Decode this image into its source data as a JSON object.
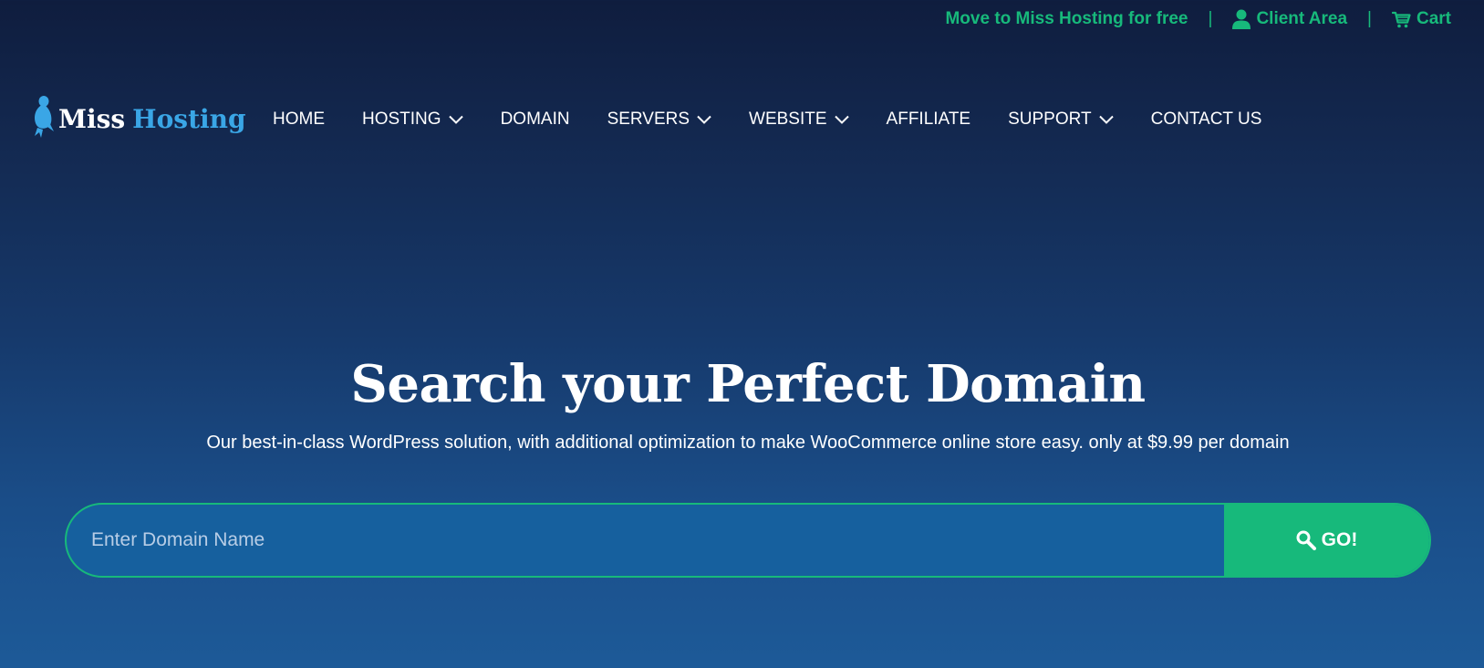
{
  "topbar": {
    "promo_label": "Move to Miss Hosting for free",
    "separator": "|",
    "client_area_label": "Client Area",
    "cart_label": "Cart",
    "icons": [
      "user-icon",
      "cart-icon"
    ]
  },
  "brand": {
    "word1": "Miss",
    "word2": "Hosting",
    "logo_icon": "bird-icon"
  },
  "nav": {
    "home": "HOME",
    "hosting": "HOSTING",
    "domain": "DOMAIN",
    "servers": "SERVERS",
    "website": "WEBSITE",
    "affiliate": "AFFILIATE",
    "support": "SUPPORT",
    "contact": "CONTACT US",
    "dropdown_icon": "chevron-down-icon"
  },
  "hero": {
    "title": "Search your Perfect Domain",
    "subtitle": "Our best-in-class WordPress solution, with additional optimization to make WooCommerce online store easy. only at $9.99 per domain"
  },
  "search": {
    "placeholder": "Enter Domain Name",
    "value": "",
    "button_label": "GO!",
    "button_icon": "search-icon"
  },
  "colors": {
    "accent": "#17b97b",
    "brand_blue": "#3aa6e6",
    "bg_top": "#0f1d3e",
    "bg_bottom": "#1d5a98",
    "input_bg": "#16609e"
  }
}
